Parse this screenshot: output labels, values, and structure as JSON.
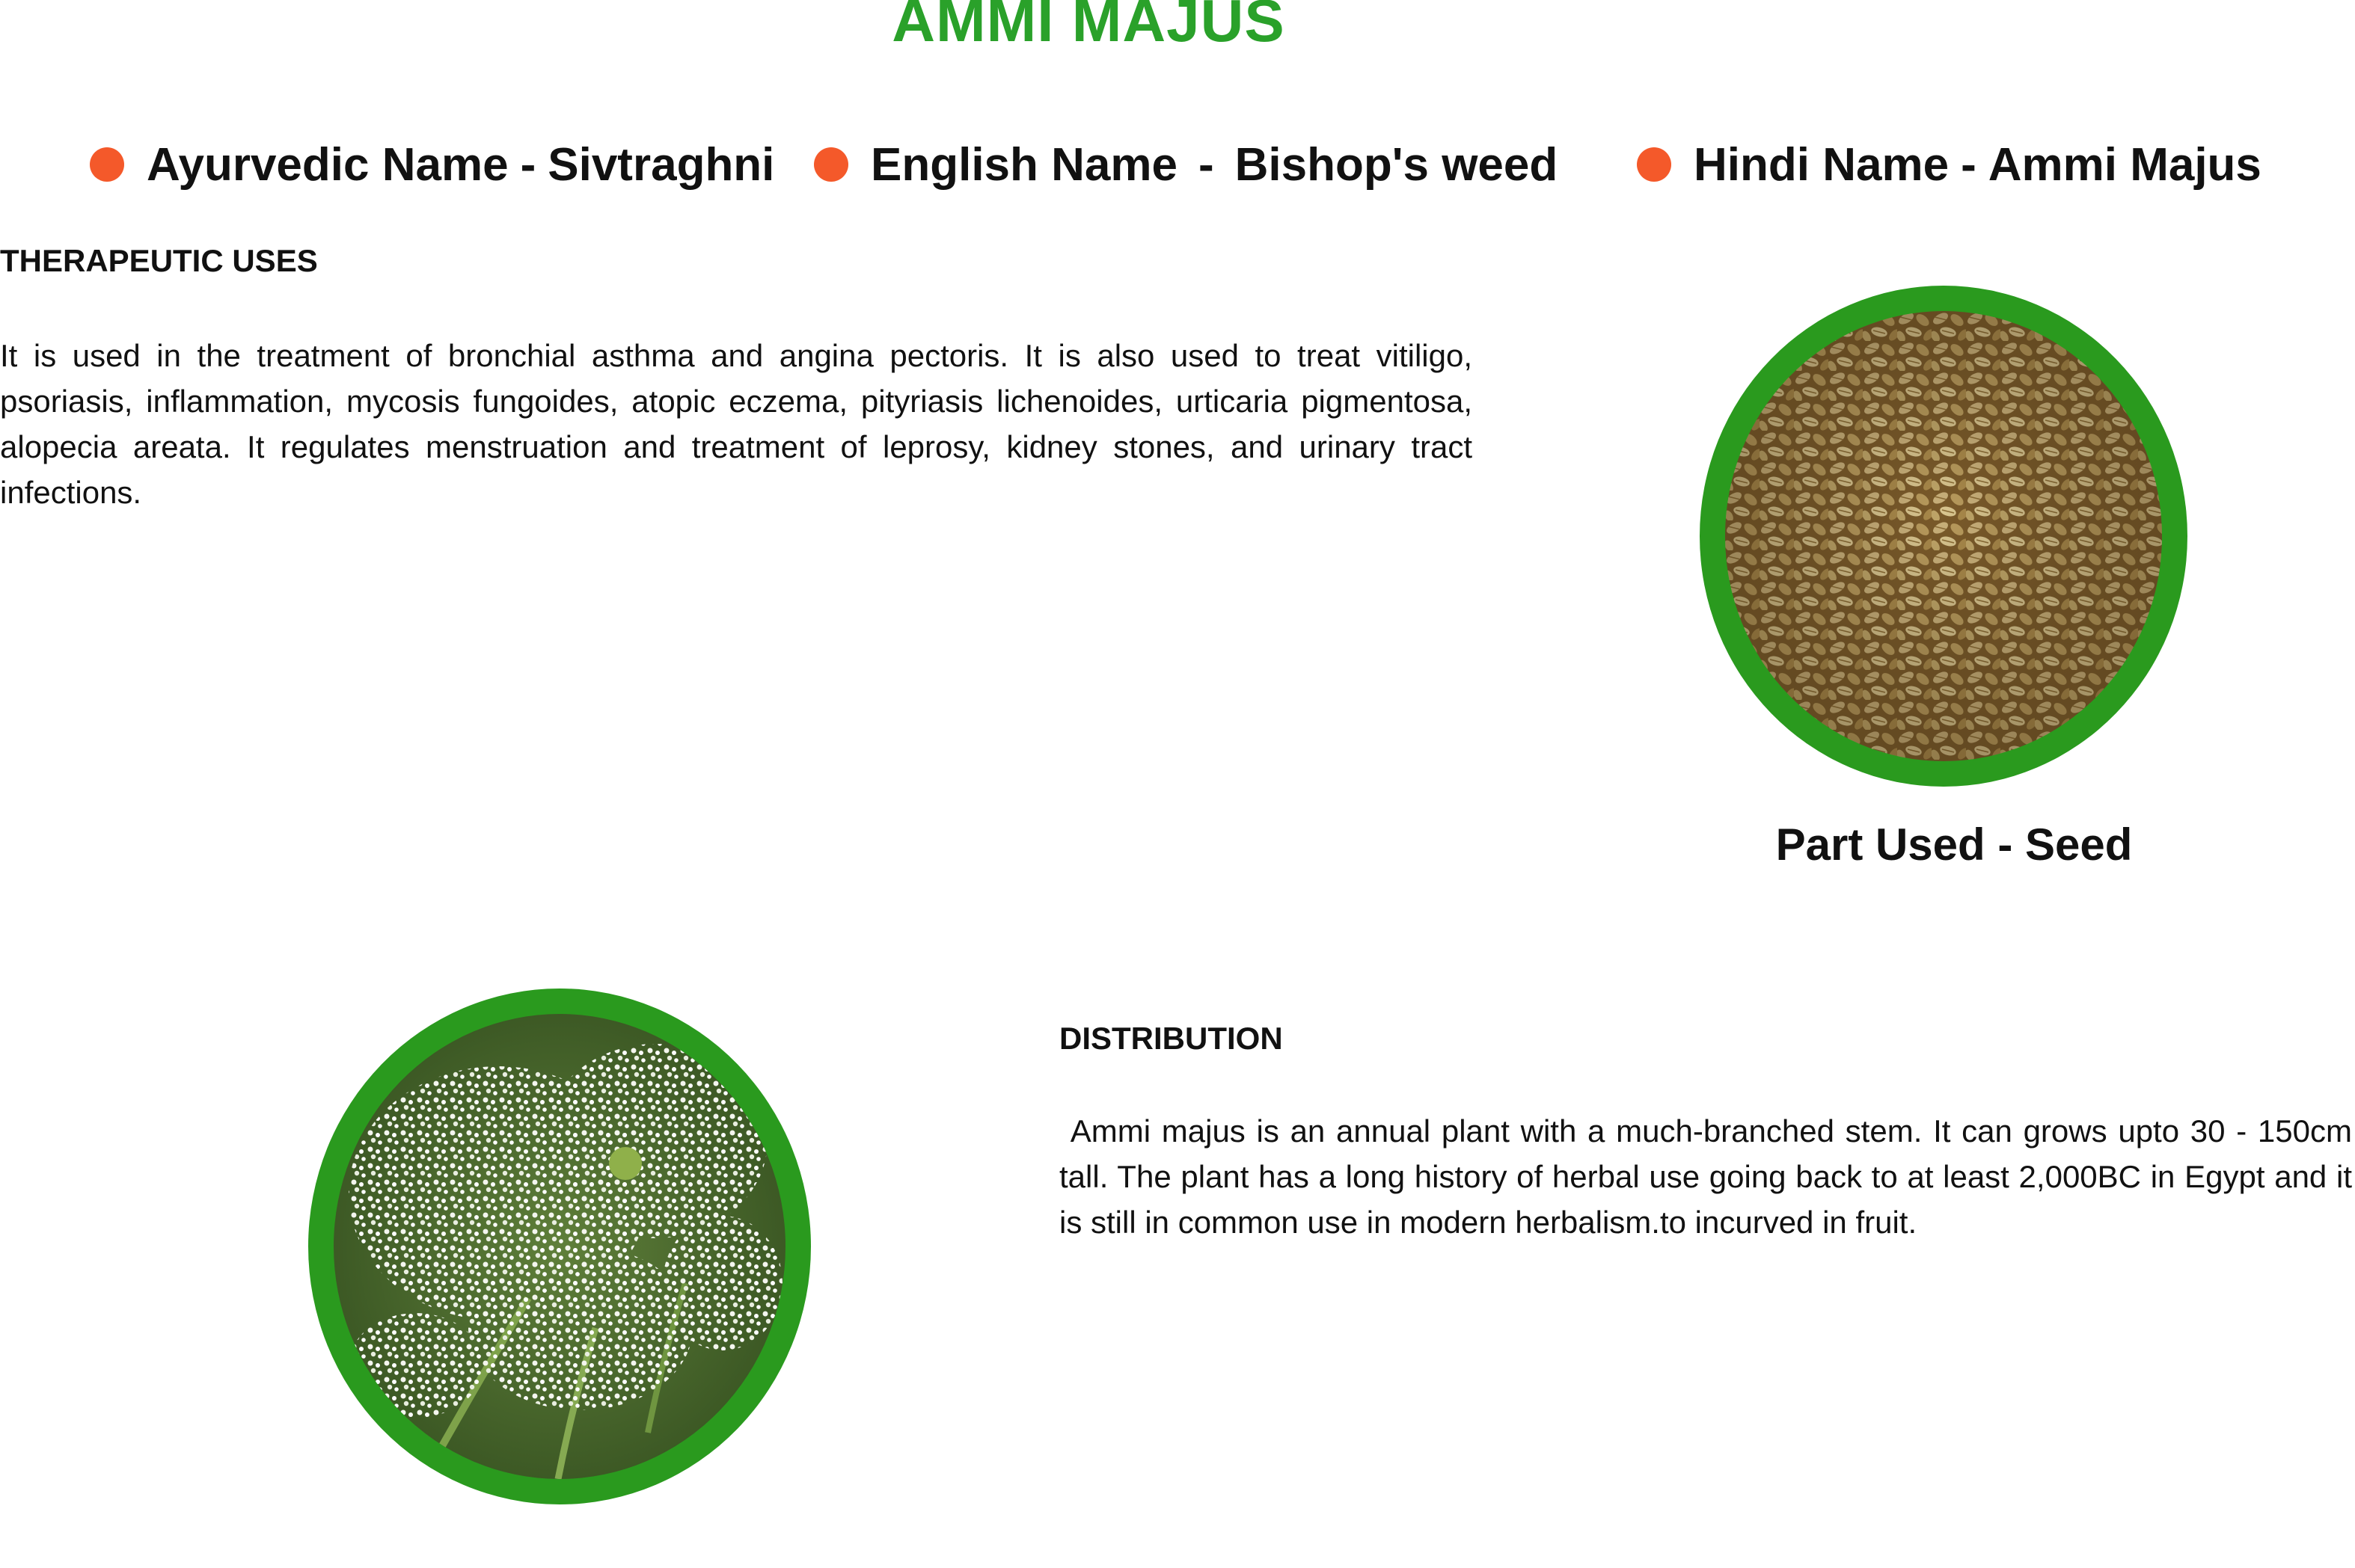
{
  "title": "AMMI MAJUS",
  "names": [
    {
      "label": "Ayurvedic Name",
      "separator": "-",
      "value": "Sivtraghni"
    },
    {
      "label": "English Name",
      "separator": "-",
      "value": "Bishop's weed"
    },
    {
      "label": "Hindi Name",
      "separator": "-",
      "value": "Ammi Majus"
    }
  ],
  "therapeutic": {
    "heading": "THERAPEUTIC USES",
    "text": "It is used in the treatment of bronchial asthma and angina pectoris. It is also used to treat vitiligo, psoriasis, inflammation, mycosis fungoides, atopic eczema, pityriasis lichenoides, urticaria pigmentosa,  alopecia areata. It regulates menstruation and treatment of leprosy, kidney stones, and urinary tract infections."
  },
  "part_used": {
    "caption": "Part Used - Seed"
  },
  "distribution": {
    "heading": "DISTRIBUTION",
    "text": " Ammi majus is an annual plant with a much-branched stem. It can grows upto 30 - 150cm tall. The plant has a long history of herbal use going back to at least 2,000BC in Egypt and it is still in common use in modern herbalism.to incurved in fruit."
  },
  "colors": {
    "title": "#2aa12a",
    "bullet": "#f4592a",
    "ring": "#2a9a1e"
  },
  "icons": [
    "seed-photo",
    "flower-photo"
  ]
}
